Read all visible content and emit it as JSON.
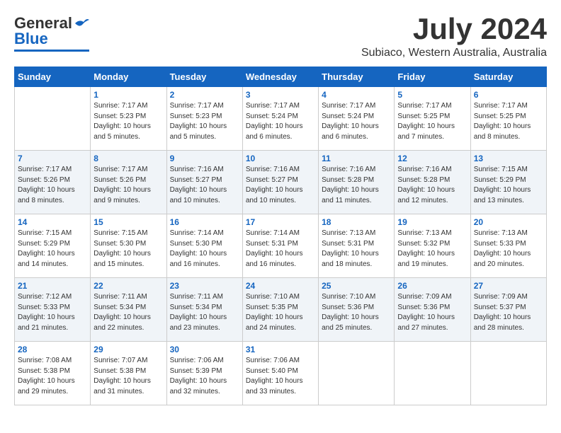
{
  "header": {
    "logo_general": "General",
    "logo_blue": "Blue",
    "month": "July 2024",
    "location": "Subiaco, Western Australia, Australia"
  },
  "weekdays": [
    "Sunday",
    "Monday",
    "Tuesday",
    "Wednesday",
    "Thursday",
    "Friday",
    "Saturday"
  ],
  "weeks": [
    [
      {
        "day": "",
        "info": ""
      },
      {
        "day": "1",
        "info": "Sunrise: 7:17 AM\nSunset: 5:23 PM\nDaylight: 10 hours\nand 5 minutes."
      },
      {
        "day": "2",
        "info": "Sunrise: 7:17 AM\nSunset: 5:23 PM\nDaylight: 10 hours\nand 5 minutes."
      },
      {
        "day": "3",
        "info": "Sunrise: 7:17 AM\nSunset: 5:24 PM\nDaylight: 10 hours\nand 6 minutes."
      },
      {
        "day": "4",
        "info": "Sunrise: 7:17 AM\nSunset: 5:24 PM\nDaylight: 10 hours\nand 6 minutes."
      },
      {
        "day": "5",
        "info": "Sunrise: 7:17 AM\nSunset: 5:25 PM\nDaylight: 10 hours\nand 7 minutes."
      },
      {
        "day": "6",
        "info": "Sunrise: 7:17 AM\nSunset: 5:25 PM\nDaylight: 10 hours\nand 8 minutes."
      }
    ],
    [
      {
        "day": "7",
        "info": "Sunrise: 7:17 AM\nSunset: 5:26 PM\nDaylight: 10 hours\nand 8 minutes."
      },
      {
        "day": "8",
        "info": "Sunrise: 7:17 AM\nSunset: 5:26 PM\nDaylight: 10 hours\nand 9 minutes."
      },
      {
        "day": "9",
        "info": "Sunrise: 7:16 AM\nSunset: 5:27 PM\nDaylight: 10 hours\nand 10 minutes."
      },
      {
        "day": "10",
        "info": "Sunrise: 7:16 AM\nSunset: 5:27 PM\nDaylight: 10 hours\nand 10 minutes."
      },
      {
        "day": "11",
        "info": "Sunrise: 7:16 AM\nSunset: 5:28 PM\nDaylight: 10 hours\nand 11 minutes."
      },
      {
        "day": "12",
        "info": "Sunrise: 7:16 AM\nSunset: 5:28 PM\nDaylight: 10 hours\nand 12 minutes."
      },
      {
        "day": "13",
        "info": "Sunrise: 7:15 AM\nSunset: 5:29 PM\nDaylight: 10 hours\nand 13 minutes."
      }
    ],
    [
      {
        "day": "14",
        "info": "Sunrise: 7:15 AM\nSunset: 5:29 PM\nDaylight: 10 hours\nand 14 minutes."
      },
      {
        "day": "15",
        "info": "Sunrise: 7:15 AM\nSunset: 5:30 PM\nDaylight: 10 hours\nand 15 minutes."
      },
      {
        "day": "16",
        "info": "Sunrise: 7:14 AM\nSunset: 5:30 PM\nDaylight: 10 hours\nand 16 minutes."
      },
      {
        "day": "17",
        "info": "Sunrise: 7:14 AM\nSunset: 5:31 PM\nDaylight: 10 hours\nand 16 minutes."
      },
      {
        "day": "18",
        "info": "Sunrise: 7:13 AM\nSunset: 5:31 PM\nDaylight: 10 hours\nand 18 minutes."
      },
      {
        "day": "19",
        "info": "Sunrise: 7:13 AM\nSunset: 5:32 PM\nDaylight: 10 hours\nand 19 minutes."
      },
      {
        "day": "20",
        "info": "Sunrise: 7:13 AM\nSunset: 5:33 PM\nDaylight: 10 hours\nand 20 minutes."
      }
    ],
    [
      {
        "day": "21",
        "info": "Sunrise: 7:12 AM\nSunset: 5:33 PM\nDaylight: 10 hours\nand 21 minutes."
      },
      {
        "day": "22",
        "info": "Sunrise: 7:11 AM\nSunset: 5:34 PM\nDaylight: 10 hours\nand 22 minutes."
      },
      {
        "day": "23",
        "info": "Sunrise: 7:11 AM\nSunset: 5:34 PM\nDaylight: 10 hours\nand 23 minutes."
      },
      {
        "day": "24",
        "info": "Sunrise: 7:10 AM\nSunset: 5:35 PM\nDaylight: 10 hours\nand 24 minutes."
      },
      {
        "day": "25",
        "info": "Sunrise: 7:10 AM\nSunset: 5:36 PM\nDaylight: 10 hours\nand 25 minutes."
      },
      {
        "day": "26",
        "info": "Sunrise: 7:09 AM\nSunset: 5:36 PM\nDaylight: 10 hours\nand 27 minutes."
      },
      {
        "day": "27",
        "info": "Sunrise: 7:09 AM\nSunset: 5:37 PM\nDaylight: 10 hours\nand 28 minutes."
      }
    ],
    [
      {
        "day": "28",
        "info": "Sunrise: 7:08 AM\nSunset: 5:38 PM\nDaylight: 10 hours\nand 29 minutes."
      },
      {
        "day": "29",
        "info": "Sunrise: 7:07 AM\nSunset: 5:38 PM\nDaylight: 10 hours\nand 31 minutes."
      },
      {
        "day": "30",
        "info": "Sunrise: 7:06 AM\nSunset: 5:39 PM\nDaylight: 10 hours\nand 32 minutes."
      },
      {
        "day": "31",
        "info": "Sunrise: 7:06 AM\nSunset: 5:40 PM\nDaylight: 10 hours\nand 33 minutes."
      },
      {
        "day": "",
        "info": ""
      },
      {
        "day": "",
        "info": ""
      },
      {
        "day": "",
        "info": ""
      }
    ]
  ]
}
